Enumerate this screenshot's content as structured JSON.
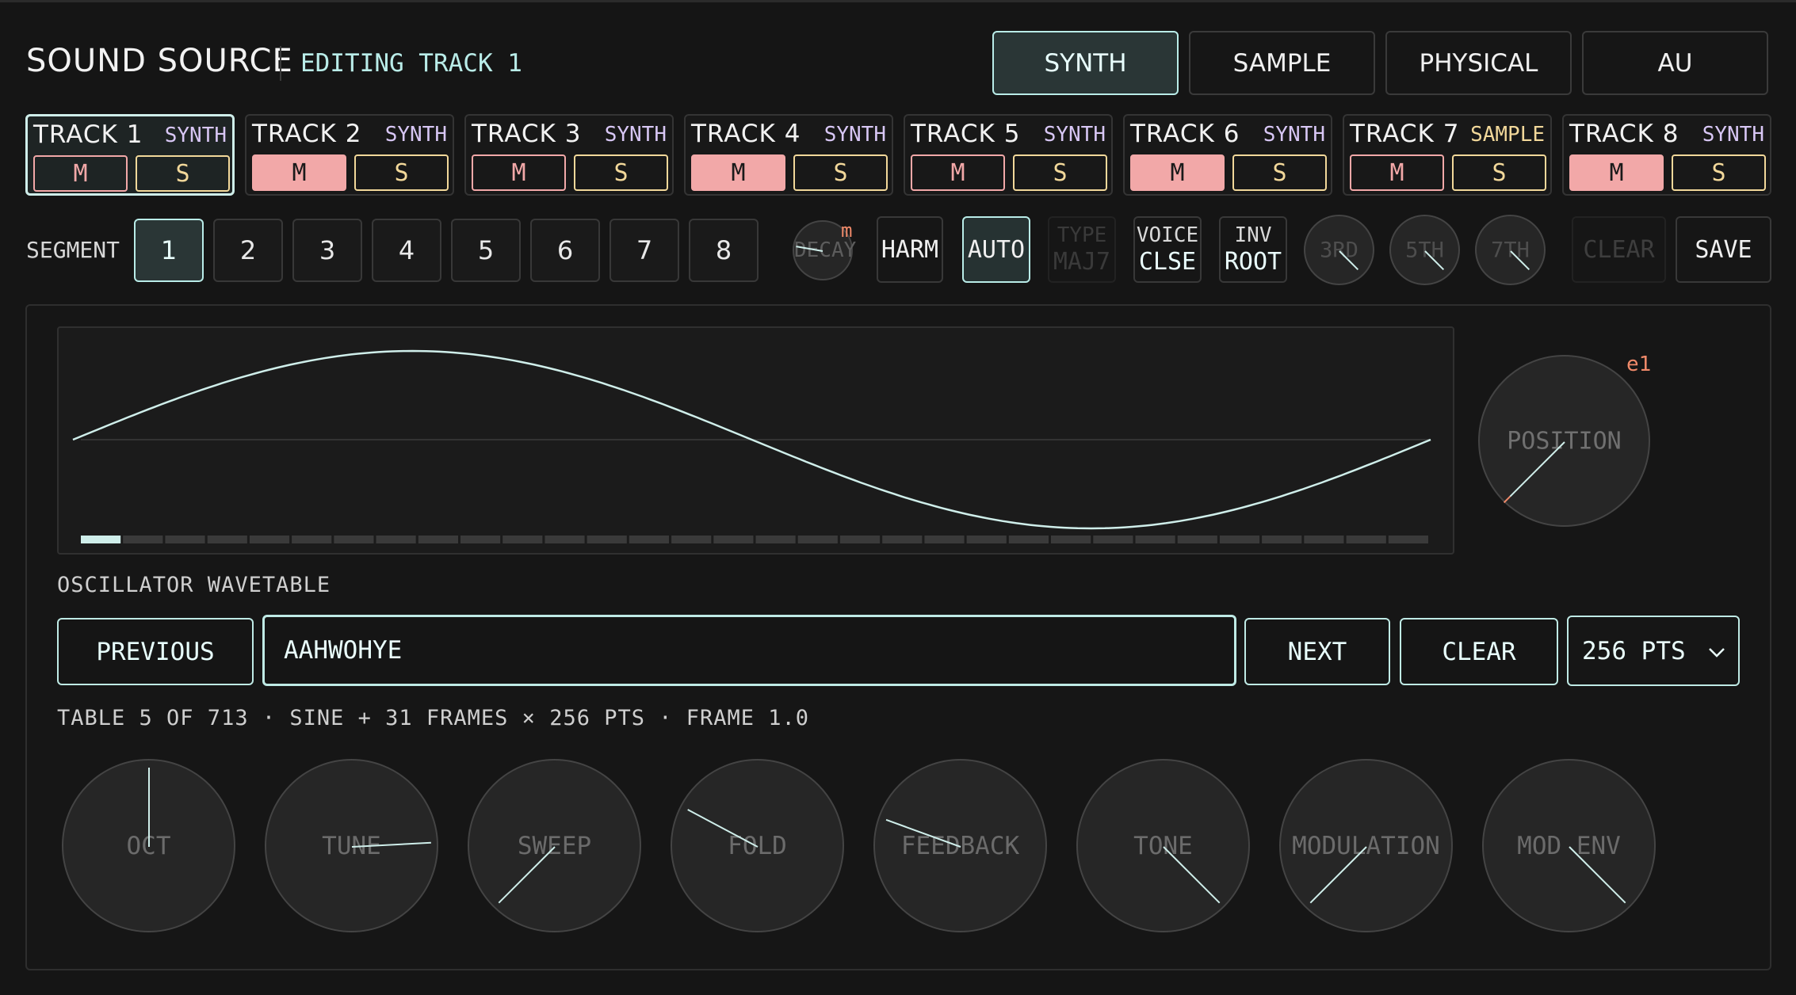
{
  "header": {
    "title": "SOUND SOURCE",
    "subtitle": "EDITING TRACK 1"
  },
  "source_tabs": [
    {
      "label": "SYNTH",
      "active": true
    },
    {
      "label": "SAMPLE",
      "active": false
    },
    {
      "label": "PHYSICAL",
      "active": false
    },
    {
      "label": "AU",
      "active": false
    }
  ],
  "tracks": [
    {
      "name": "TRACK 1",
      "type": "SYNTH",
      "mute": "M",
      "solo": "S",
      "muted": false,
      "active": true
    },
    {
      "name": "TRACK 2",
      "type": "SYNTH",
      "mute": "M",
      "solo": "S",
      "muted": true,
      "active": false
    },
    {
      "name": "TRACK 3",
      "type": "SYNTH",
      "mute": "M",
      "solo": "S",
      "muted": false,
      "active": false
    },
    {
      "name": "TRACK 4",
      "type": "SYNTH",
      "mute": "M",
      "solo": "S",
      "muted": true,
      "active": false
    },
    {
      "name": "TRACK 5",
      "type": "SYNTH",
      "mute": "M",
      "solo": "S",
      "muted": false,
      "active": false
    },
    {
      "name": "TRACK 6",
      "type": "SYNTH",
      "mute": "M",
      "solo": "S",
      "muted": true,
      "active": false
    },
    {
      "name": "TRACK 7",
      "type": "SAMPLE",
      "mute": "M",
      "solo": "S",
      "muted": false,
      "active": false
    },
    {
      "name": "TRACK 8",
      "type": "SYNTH",
      "mute": "M",
      "solo": "S",
      "muted": true,
      "active": false
    }
  ],
  "segment": {
    "label": "SEGMENT",
    "buttons": [
      "1",
      "2",
      "3",
      "4",
      "5",
      "6",
      "7",
      "8"
    ],
    "selected": "1"
  },
  "chord": {
    "decay_label": "DECAY",
    "decay_badge": "m",
    "harm_label": "HARM",
    "auto_label": "AUTO",
    "type_label": "TYPE",
    "type_value": "MAJ7",
    "voice_label": "VOICE",
    "voice_value": "CLSE",
    "inv_label": "INV",
    "inv_value": "ROOT",
    "interval_knobs": [
      "3RD",
      "5TH",
      "7TH"
    ],
    "clear_label": "CLEAR",
    "save_label": "SAVE"
  },
  "wavetable": {
    "label": "OSCILLATOR WAVETABLE",
    "frame_count": 32,
    "current_frame": 1,
    "position_label": "POSITION",
    "position_badge": "e1",
    "previous_label": "PREVIOUS",
    "name": "AAHWOHYE",
    "next_label": "NEXT",
    "clear_label": "CLEAR",
    "resolution": "256 PTS",
    "info": "TABLE 5 OF 713 · SINE + 31 FRAMES × 256 PTS · FRAME 1.0"
  },
  "knobs": [
    {
      "label": "OCT"
    },
    {
      "label": "TUNE"
    },
    {
      "label": "SWEEP"
    },
    {
      "label": "FOLD"
    },
    {
      "label": "FEEDBACK"
    },
    {
      "label": "TONE"
    },
    {
      "label": "MODULATION"
    },
    {
      "label": "MOD ENV"
    }
  ],
  "colors": {
    "accent": "#b9ece8",
    "mute": "#f2a8a8",
    "solo": "#f2d89a",
    "synth_type": "#d8c7f5",
    "badge": "#f08a6a"
  }
}
